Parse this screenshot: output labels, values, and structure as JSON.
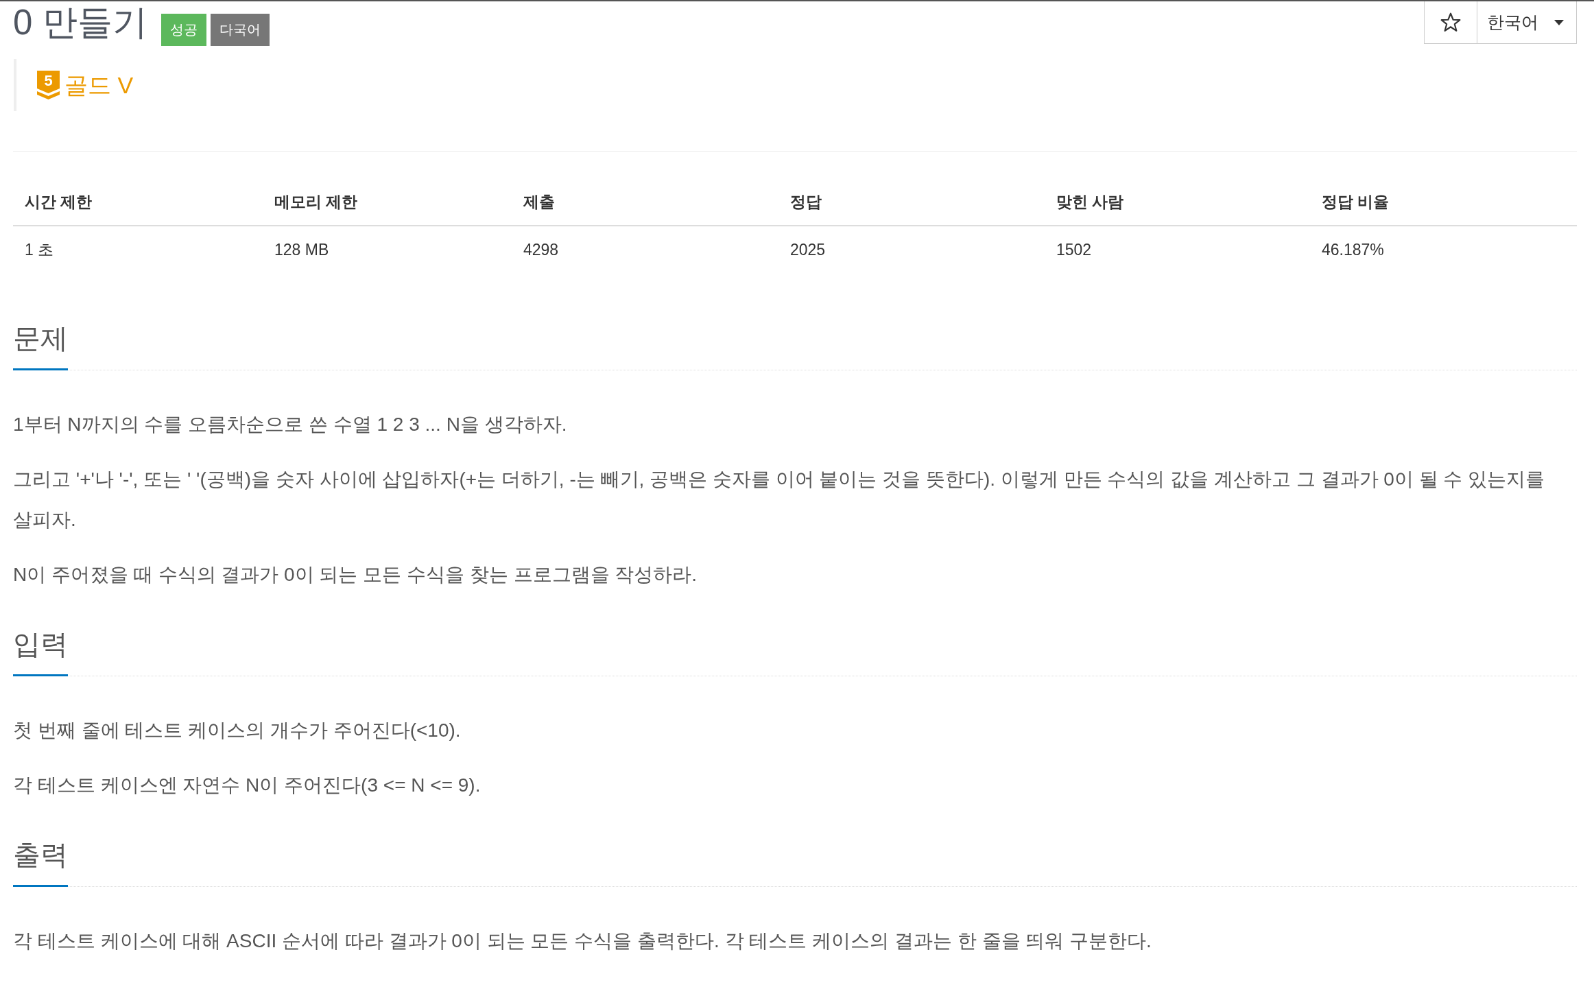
{
  "header": {
    "title": "0 만들기",
    "labels": [
      {
        "text": "성공",
        "kind": "success"
      },
      {
        "text": "다국어",
        "kind": "multilingual"
      }
    ],
    "favorite": {
      "starred": false
    },
    "language": {
      "value": "한국어"
    }
  },
  "tier": {
    "level": "5",
    "name": "골드 V"
  },
  "stats": {
    "columns": [
      "시간 제한",
      "메모리 제한",
      "제출",
      "정답",
      "맞힌 사람",
      "정답 비율"
    ],
    "rows": [
      [
        "1 초",
        "128 MB",
        "4298",
        "2025",
        "1502",
        "46.187%"
      ]
    ]
  },
  "sections": [
    {
      "heading": "문제",
      "paragraphs": [
        "1부터 N까지의 수를 오름차순으로 쓴 수열 1 2 3 ... N을 생각하자.",
        "그리고 '+'나 '-', 또는 ' '(공백)을 숫자 사이에 삽입하자(+는 더하기, -는 빼기, 공백은 숫자를 이어 붙이는 것을 뜻한다). 이렇게 만든 수식의 값을 계산하고 그 결과가 0이 될 수 있는지를 살피자.",
        "N이 주어졌을 때 수식의 결과가 0이 되는 모든 수식을 찾는 프로그램을 작성하라."
      ]
    },
    {
      "heading": "입력",
      "paragraphs": [
        "첫 번째 줄에 테스트 케이스의 개수가 주어진다(<10).",
        "각 테스트 케이스엔 자연수 N이 주어진다(3 <= N <= 9)."
      ]
    },
    {
      "heading": "출력",
      "paragraphs": [
        "각 테스트 케이스에 대해 ASCII 순서에 따라 결과가 0이 되는 모든 수식을 출력한다. 각 테스트 케이스의 결과는 한 줄을 띄워 구분한다."
      ]
    }
  ]
}
